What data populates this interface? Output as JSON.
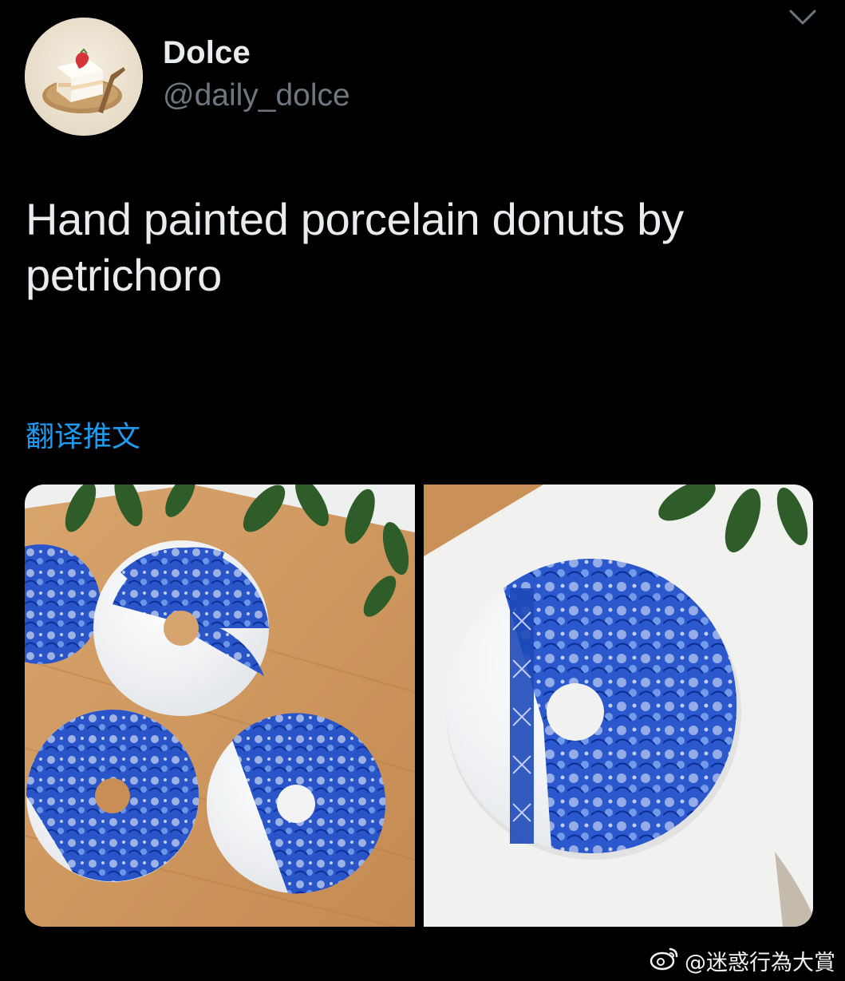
{
  "tweet": {
    "display_name": "Dolce",
    "handle": "@daily_dolce",
    "text": "Hand painted porcelain donuts by petrichoro",
    "translate_label": "翻译推文",
    "menu_icon": "chevron-down-icon",
    "avatar_icon": "strawberry-cake-avatar",
    "media": [
      {
        "name": "porcelain-donuts-on-board-photo"
      },
      {
        "name": "porcelain-donut-closeup-photo"
      }
    ]
  },
  "watermark": {
    "logo": "weibo-logo",
    "text": "@迷惑行為大賞"
  },
  "colors": {
    "background": "#000000",
    "primary_text": "#e9ecee",
    "secondary_text": "#6e7780",
    "link": "#1d9bf0"
  }
}
